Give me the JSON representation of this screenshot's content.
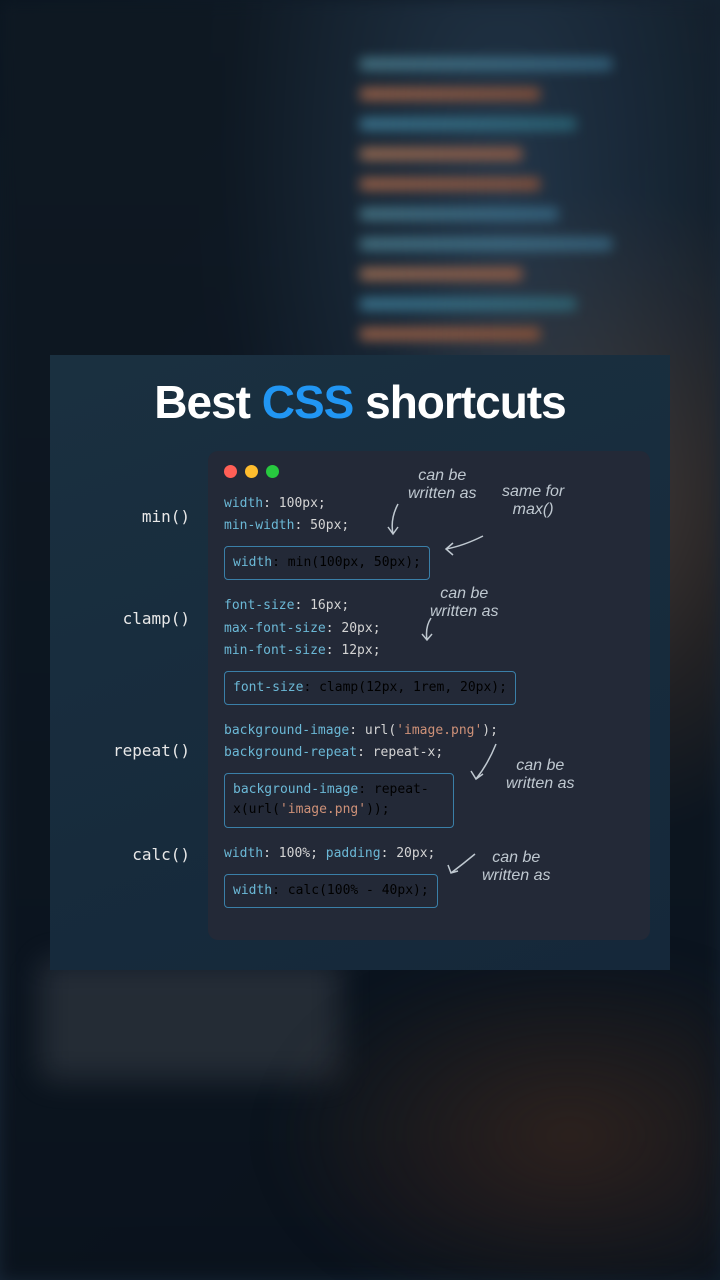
{
  "title": {
    "before": "Best ",
    "emphasis": "CSS",
    "after": " shortcuts"
  },
  "labels": {
    "min": "min()",
    "clamp": "clamp()",
    "repeat": "repeat()",
    "calc": "calc()"
  },
  "annotations": {
    "can_be_1": "can be\nwritten as",
    "same_for_max": "same for\nmax()",
    "can_be_2": "can be\nwritten as",
    "can_be_3": "can be\nwritten as",
    "can_be_4": "can be\nwritten as"
  },
  "code": {
    "min_line1_prop": "width",
    "min_line1_val": ": 100px;",
    "min_line2_prop": "min-width",
    "min_line2_val": ": 50px;",
    "min_box_prop": "width",
    "min_box_val": ": min(100px, 50px);",
    "clamp_line1_prop": "font-size",
    "clamp_line1_val": ": 16px;",
    "clamp_line2_prop": "max-font-size",
    "clamp_line2_val": ": 20px;",
    "clamp_line3_prop": "min-font-size",
    "clamp_line3_val": ": 12px;",
    "clamp_box_prop": "font-size",
    "clamp_box_val": ": clamp(12px, 1rem, 20px);",
    "repeat_line1_prop": "background-image",
    "repeat_line1_val_a": ": url(",
    "repeat_line1_str": "'image.png'",
    "repeat_line1_val_b": ");",
    "repeat_line2_prop": "background-repeat",
    "repeat_line2_val": ": repeat-x;",
    "repeat_box_prop": "background-image",
    "repeat_box_val_a": ": repeat-x(url(",
    "repeat_box_str": "'image.png'",
    "repeat_box_val_b": "));",
    "calc_line1_prop1": "width",
    "calc_line1_val1": ": 100%; ",
    "calc_line1_prop2": "padding",
    "calc_line1_val2": ": 20px;",
    "calc_box_prop": "width",
    "calc_box_val": ": calc(100% - 40px);"
  }
}
